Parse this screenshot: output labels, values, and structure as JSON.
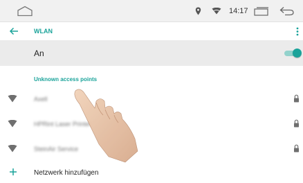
{
  "status_bar": {
    "icons": [
      "home-icon",
      "location-icon",
      "wifi-icon",
      "window-icon",
      "back-icon"
    ],
    "time": "14:17"
  },
  "app_bar": {
    "title": "WLAN",
    "back_icon": "back-arrow-icon",
    "menu_icon": "overflow-menu-icon"
  },
  "wifi_toggle": {
    "label": "An",
    "state": "on"
  },
  "unknown_section": {
    "title": "Unknown access points",
    "items": [
      {
        "name": "Axell",
        "secured": true
      },
      {
        "name": "HPRint Laser Printer",
        "secured": true
      },
      {
        "name": "SteinAir Service",
        "secured": true
      }
    ]
  },
  "add_network": {
    "label": "Netzwerk hinzufügen",
    "icon": "plus-icon"
  },
  "colors": {
    "accent": "#1aa39a",
    "status_bar_bg": "#f1f1f1",
    "toggle_row_bg": "#ebebeb",
    "icon_gray": "#777777"
  }
}
